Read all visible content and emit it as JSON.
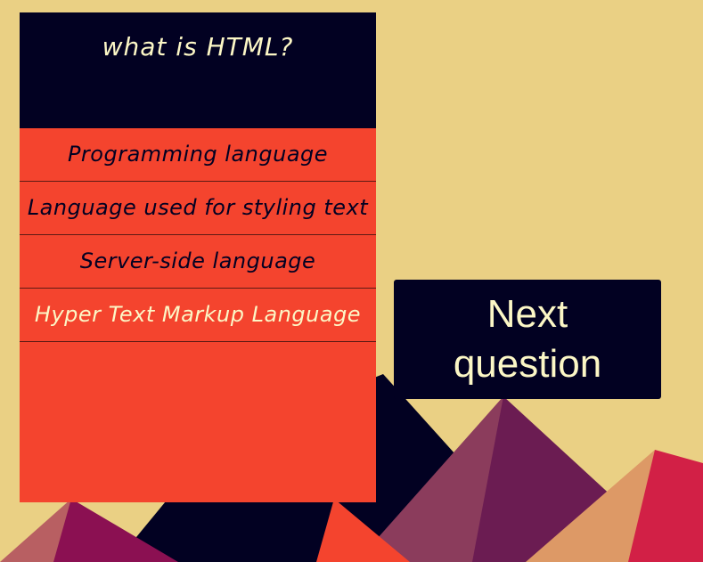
{
  "quiz": {
    "question": "what is HTML?",
    "answers": [
      {
        "label": "Programming language",
        "correct": false
      },
      {
        "label": "Language used for styling text",
        "correct": false
      },
      {
        "label": "Server-side language",
        "correct": false
      },
      {
        "label": "Hyper Text Markup Language",
        "correct": true
      }
    ],
    "next_label_line1": "Next",
    "next_label_line2": "question"
  },
  "colors": {
    "background": "#ead084",
    "card": "#f4442e",
    "question_bg": "#020122",
    "light_text": "#fcf7c6",
    "mountain_navy": "#020122",
    "mountain_plum": "#6b1c52",
    "mountain_mauve": "#8b3c5c",
    "mountain_peach": "#dd9966",
    "mountain_crimson": "#d22046"
  }
}
